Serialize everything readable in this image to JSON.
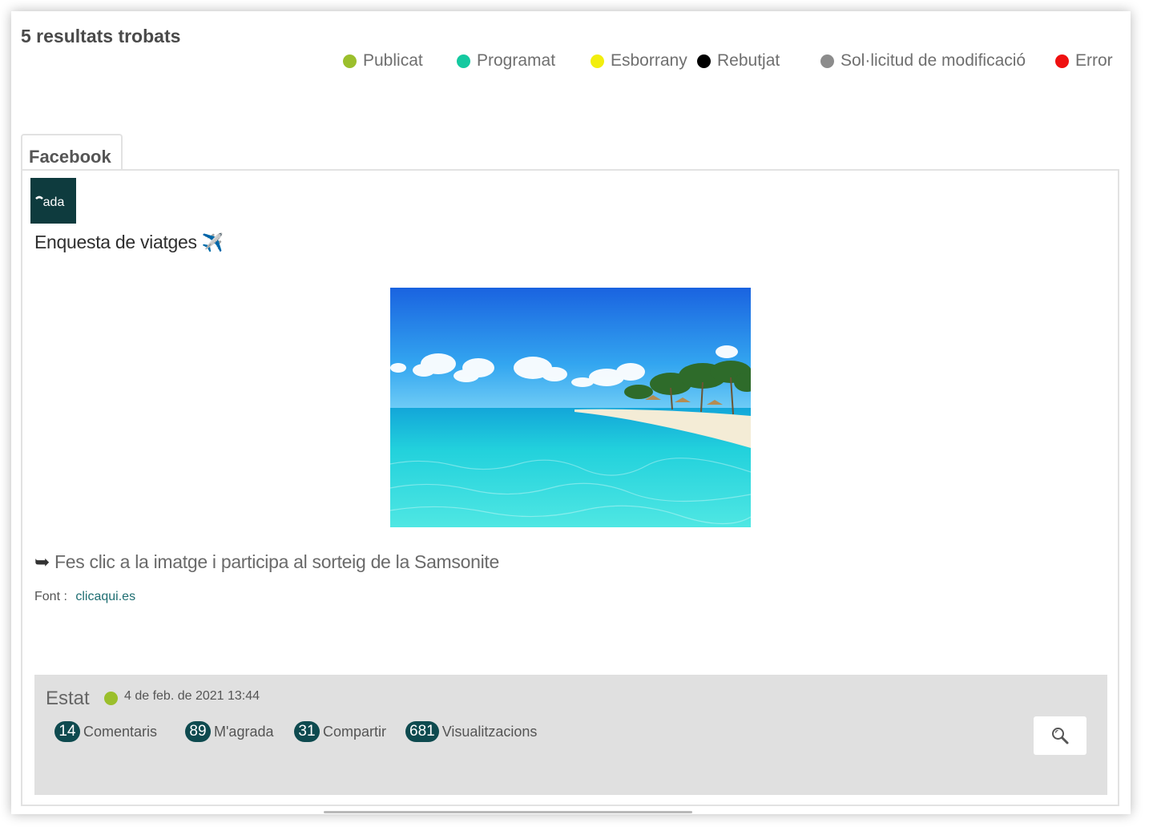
{
  "results": {
    "title": "5 resultats trobats"
  },
  "legend": [
    {
      "label": "Publicat",
      "color": "#9bbf2c"
    },
    {
      "label": "Programat",
      "color": "#14c9a0"
    },
    {
      "label": "Esborrany",
      "color": "#f2ee0d"
    },
    {
      "label": "Rebutjat",
      "color": "#000000"
    },
    {
      "label": "Sol·licitud de modificació",
      "color": "#8c8c8c"
    },
    {
      "label": "Error",
      "color": "#ef1010"
    }
  ],
  "tabs": {
    "facebook": "Facebook"
  },
  "post": {
    "avatar_text": "ada",
    "title": "Enquesta de viatges",
    "title_icon": "✈️",
    "text_arrow": "➥",
    "text": "Fes clic a la imatge i participa al sorteig de la Samsonite",
    "source_label": "Font",
    "source_sep": ":",
    "source_link": "clicaqui.es"
  },
  "status": {
    "label": "Estat",
    "dot_color": "#9bbf2c",
    "date": "4 de feb. de 2021 13:44"
  },
  "stats": [
    {
      "count": "14",
      "label": "Comentaris"
    },
    {
      "count": "89",
      "label": "M'agrada"
    },
    {
      "count": "31",
      "label": "Compartir"
    },
    {
      "count": "681",
      "label": "Visualitzacions"
    }
  ],
  "actions": {
    "view_icon": "search-icon"
  }
}
